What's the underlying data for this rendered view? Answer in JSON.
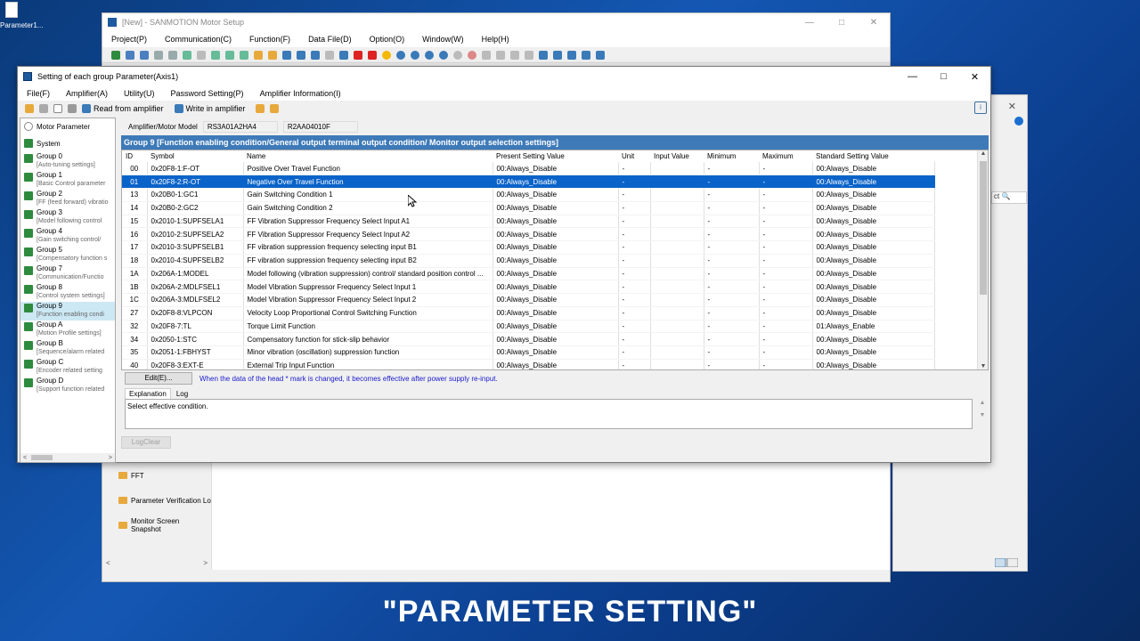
{
  "desktop": {
    "icon_label": "Parameter1..."
  },
  "back_window": {
    "title": "[New] - SANMOTION Motor Setup",
    "menu": [
      "Project(P)",
      "Communication(C)",
      "Function(F)",
      "Data File(D)",
      "Option(O)",
      "Window(W)",
      "Help(H)"
    ],
    "left_items": [
      "FFT",
      "Parameter Verification Lo",
      "Monitor Screen Snapshot"
    ]
  },
  "side_window": {
    "search_text": "ct"
  },
  "main_window": {
    "title": "Setting of each group Parameter(Axis1)",
    "menu": [
      "File(F)",
      "Amplifier(A)",
      "Utility(U)",
      "Password Setting(P)",
      "Amplifier Information(I)"
    ],
    "toolbar": {
      "read_label": "Read from amplifier",
      "write_label": "Write in amplifier"
    },
    "tree": {
      "root": "Motor Parameter",
      "system": "System",
      "groups": [
        {
          "name": "Group 0",
          "desc": "[Auto-tuning settings]"
        },
        {
          "name": "Group 1",
          "desc": "[Basic Control parameter"
        },
        {
          "name": "Group 2",
          "desc": "[FF (feed forward) vibratio"
        },
        {
          "name": "Group 3",
          "desc": "[Model following control"
        },
        {
          "name": "Group 4",
          "desc": "[Gain switching control/"
        },
        {
          "name": "Group 5",
          "desc": "[Compensatory function s"
        },
        {
          "name": "Group 7",
          "desc": "[Communication/Functio"
        },
        {
          "name": "Group 8",
          "desc": "[Control system settings]"
        },
        {
          "name": "Group 9",
          "desc": "[Function enabling condi"
        },
        {
          "name": "Group A",
          "desc": "[Motion Profile settings]"
        },
        {
          "name": "Group B",
          "desc": "[Sequence/alarm related"
        },
        {
          "name": "Group C",
          "desc": "[Encoder related setting"
        },
        {
          "name": "Group D",
          "desc": "[Support function related"
        }
      ]
    },
    "model_label": "Amplifier/Motor Model",
    "amp_model": "RS3A01A2HA4",
    "motor_model": "R2AA04010F",
    "group_header": "Group 9 [Function enabling condition/General output terminal output condition/ Monitor output selection settings]",
    "columns": [
      "ID",
      "Symbol",
      "Name",
      "Present Setting Value",
      "Unit",
      "Input Value",
      "Minimum",
      "Maximum",
      "Standard Setting Value"
    ],
    "rows": [
      [
        "00",
        "0x20F8-1:F-OT",
        "Positive Over Travel Function",
        "00:Always_Disable",
        "-",
        "",
        "-",
        "-",
        "00:Always_Disable"
      ],
      [
        "01",
        "0x20F8-2:R-OT",
        "Negative Over Travel Function",
        "00:Always_Disable",
        "-",
        "",
        "-",
        "-",
        "00:Always_Disable"
      ],
      [
        "13",
        "0x20B0-1:GC1",
        "Gain Switching Condition 1",
        "00:Always_Disable",
        "-",
        "",
        "-",
        "-",
        "00:Always_Disable"
      ],
      [
        "14",
        "0x20B0-2:GC2",
        "Gain Switching Condition 2",
        "00:Always_Disable",
        "-",
        "",
        "-",
        "-",
        "00:Always_Disable"
      ],
      [
        "15",
        "0x2010-1:SUPFSELA1",
        "FF Vibration Suppressor Frequency Select Input A1",
        "00:Always_Disable",
        "-",
        "",
        "-",
        "-",
        "00:Always_Disable"
      ],
      [
        "16",
        "0x2010-2:SUPFSELA2",
        "FF Vibration Suppressor Frequency Select Input A2",
        "00:Always_Disable",
        "-",
        "",
        "-",
        "-",
        "00:Always_Disable"
      ],
      [
        "17",
        "0x2010-3:SUPFSELB1",
        "FF vibration suppression frequency selecting input B1",
        "00:Always_Disable",
        "-",
        "",
        "-",
        "-",
        "00:Always_Disable"
      ],
      [
        "18",
        "0x2010-4:SUPFSELB2",
        "FF vibration suppression frequency selecting input B2",
        "00:Always_Disable",
        "-",
        "",
        "-",
        "-",
        "00:Always_Disable"
      ],
      [
        "1A",
        "0x206A-1:MODEL",
        "Model following (vibration suppression) control/ standard position control ...",
        "00:Always_Disable",
        "-",
        "",
        "-",
        "-",
        "00:Always_Disable"
      ],
      [
        "1B",
        "0x206A-2:MDLFSEL1",
        "Model Vibration Suppressor Frequency Select Input 1",
        "00:Always_Disable",
        "-",
        "",
        "-",
        "-",
        "00:Always_Disable"
      ],
      [
        "1C",
        "0x206A-3:MDLFSEL2",
        "Model Vibration Suppressor Frequency Select Input 2",
        "00:Always_Disable",
        "-",
        "",
        "-",
        "-",
        "00:Always_Disable"
      ],
      [
        "27",
        "0x20F8-8:VLPCON",
        "Velocity Loop Proportional Control Switching Function",
        "00:Always_Disable",
        "-",
        "",
        "-",
        "-",
        "00:Always_Disable"
      ],
      [
        "32",
        "0x20F8-7:TL",
        "Torque Limit Function",
        "00:Always_Disable",
        "-",
        "",
        "-",
        "-",
        "01:Always_Enable"
      ],
      [
        "34",
        "0x2050-1:STC",
        "Compensatory function for stick-slip behavior",
        "00:Always_Disable",
        "-",
        "",
        "-",
        "-",
        "00:Always_Disable"
      ],
      [
        "35",
        "0x2051-1:FBHYST",
        "Minor vibration (oscillation) suppression function",
        "00:Always_Disable",
        "-",
        "",
        "-",
        "-",
        "00:Always_Disable"
      ],
      [
        "40",
        "0x20F8-3:EXT-E",
        "External Trip Input Function",
        "00:Always_Disable",
        "-",
        "",
        "-",
        "-",
        "00:Always_Disable"
      ]
    ],
    "selected_row": 1,
    "edit_label": "Edit(E)...",
    "notice": "When the data of the head * mark is changed, it becomes effective after power supply re-input.",
    "tabs": [
      "Explanation",
      "Log"
    ],
    "explanation": "Select effective condition.",
    "logclear_label": "LogClear"
  },
  "caption": "\"PARAMETER SETTING\""
}
